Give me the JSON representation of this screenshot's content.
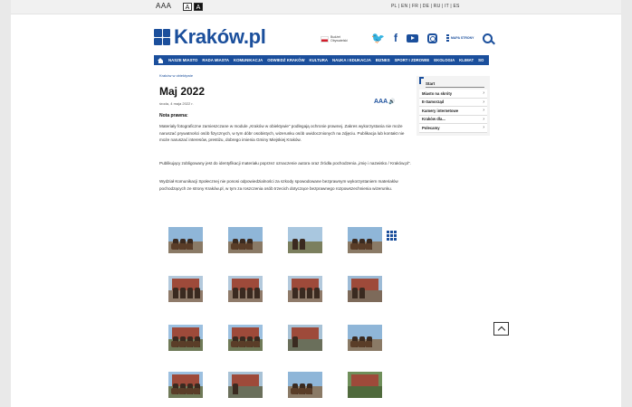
{
  "utility": {
    "font_size_label": "AAA",
    "contrast_normal": "A",
    "contrast_high": "A",
    "languages": "PL | EN | FR | DE | RU | IT | ES"
  },
  "header": {
    "logo_text": "Kraków.pl",
    "budget_text": "Budżet Obywatelski",
    "map_label": "MAPA STRONY",
    "accent": "#1b4f9c"
  },
  "nav": {
    "items": [
      "NASZE MIASTO",
      "RADA MIASTA",
      "KOMUNIKACJA",
      "ODWIEDŹ KRAKÓW",
      "KULTURA",
      "NAUKA I EDUKACJA",
      "BIZNES",
      "SPORT I ZDROWIE",
      "EKOLOGIA",
      "KLIMAT",
      "SO"
    ]
  },
  "content": {
    "breadcrumb": "Kraków w obiektywie",
    "title": "Maj 2022",
    "date": "środa, 4 maja 2022 r.",
    "tts_label": "AAA",
    "note_heading": "Nota prawna:",
    "paragraph1": "Materiały fotograficzne zamieszczane w module „Kraków w obiektywie” podlegają ochronie prawnej. Zakres wykorzystania nie może naruszać prywatności osób fizycznych, w tym dóbr osobistych, wizerunku osób uwidocznionych na zdjęciu. Publikacja lub kontakt nie może naruszać interesów, prestiżu, dobrego imienia Gminy Miejskiej Kraków.",
    "paragraph2": "Publikujący zobligowany jest do identyfikacji materiału poprzez oznaczenie autora oraz źródła pochodzenia „imię i nazwisko / Kraków.pl”.",
    "paragraph3": "Wydział Komunikacji Społecznej nie ponosi odpowiedzialności za szkody spowodowane bezprawnym wykorzystaniem materiałów pochodzących ze strony Kraków.pl, w tym za roszczenia osób trzecich dotyczące bezprawnego rozpowszechnienia wizerunku."
  },
  "sidebar": {
    "heading": "Start",
    "items": [
      {
        "label": "Miasto na skróty"
      },
      {
        "label": "E-Samorząd"
      },
      {
        "label": "Kamery internetowe"
      },
      {
        "label": "Kraków dla..."
      },
      {
        "label": "Polecamy"
      }
    ]
  },
  "gallery": {
    "thumbs": [
      {
        "kind": "cavalry"
      },
      {
        "kind": "cavalry"
      },
      {
        "kind": "cannon"
      },
      {
        "kind": "cavalry"
      },
      {
        "kind": "parade"
      },
      {
        "kind": "parade"
      },
      {
        "kind": "parade"
      },
      {
        "kind": "monument"
      },
      {
        "kind": "barbican"
      },
      {
        "kind": "barbican"
      },
      {
        "kind": "vehicle"
      },
      {
        "kind": "cavalry"
      },
      {
        "kind": "barbican"
      },
      {
        "kind": "vehicle"
      },
      {
        "kind": "cavalry"
      },
      {
        "kind": "aerial"
      }
    ]
  }
}
